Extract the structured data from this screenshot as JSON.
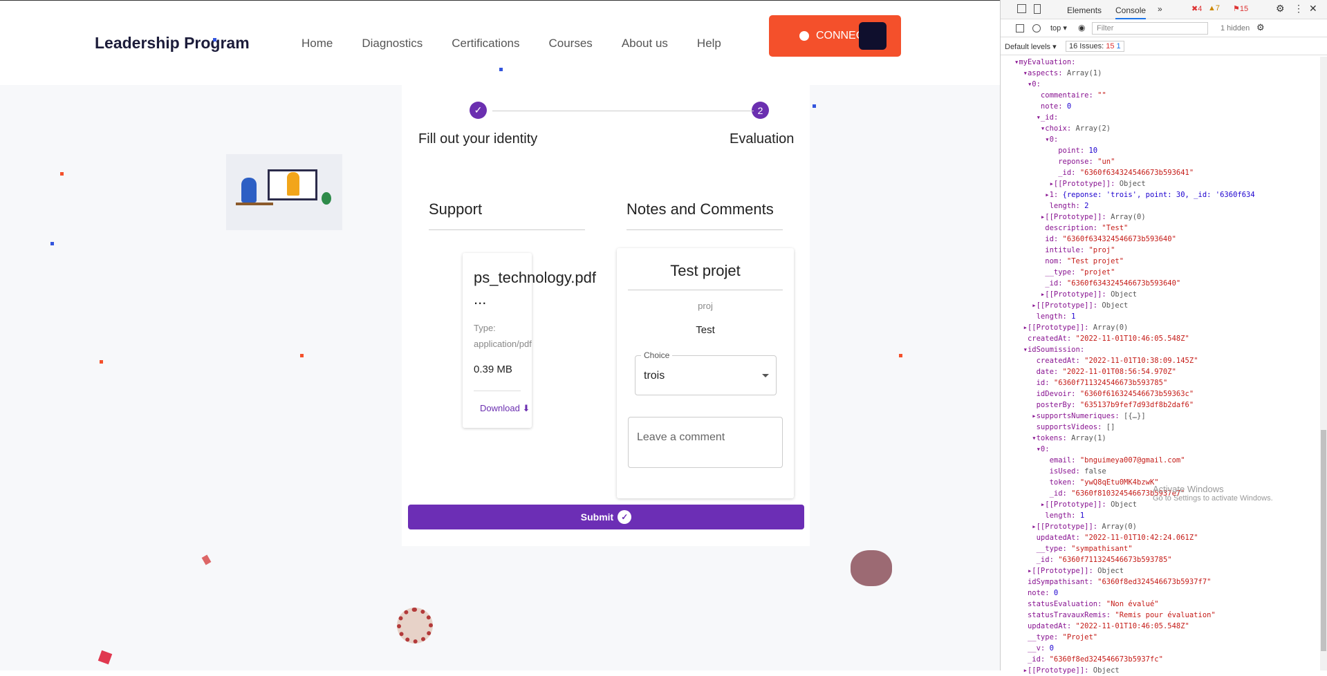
{
  "nav": {
    "brand": "Leadership Program",
    "links": [
      "Home",
      "Diagnostics",
      "Certifications",
      "Courses",
      "About us",
      "Help"
    ],
    "connect": "CONNECT"
  },
  "steps": {
    "step1": "Fill out your identity",
    "step2": "Evaluation",
    "step2_num": "2"
  },
  "support": {
    "title": "Support",
    "file_name": "ps_technology.pdf",
    "ellipsis": "...",
    "type": "Type: application/pdf",
    "size": "0.39 MB",
    "download": "Download"
  },
  "notes": {
    "title": "Notes and Comments",
    "project": "Test projet",
    "intitule": "proj",
    "description": "Test",
    "choice_label": "Choice",
    "choice_value": "trois",
    "comment_placeholder": "Leave a comment"
  },
  "submit": "Submit",
  "devtools": {
    "tabs": [
      "Elements",
      "Console"
    ],
    "errors": "4",
    "warnings": "7",
    "issues_badge": "15",
    "top": "top",
    "filter": "Filter",
    "hidden": "1 hidden",
    "levels": "Default levels",
    "issues": "16 Issues:",
    "issues_err": "15",
    "issues_info": "1",
    "watermark1": "Activate Windows",
    "watermark2": "Go to Settings to activate Windows."
  },
  "tree": [
    "▾myEvaluation:",
    "  ▾aspects: Array(1)",
    "   ▾0:",
    "      commentaire: \"\"",
    "      note: 0",
    "     ▾_id:",
    "      ▾choix: Array(2)",
    "       ▾0:",
    "          point: 10",
    "          reponse: \"un\"",
    "          _id: \"6360f634324546673b593641\"",
    "        ▸[[Prototype]]: Object",
    "       ▸1: {reponse: 'trois', point: 30, _id: '6360f634",
    "        length: 2",
    "      ▸[[Prototype]]: Array(0)",
    "       description: \"Test\"",
    "       id: \"6360f634324546673b593640\"",
    "       intitule: \"proj\"",
    "       nom: \"Test projet\"",
    "       __type: \"projet\"",
    "       _id: \"6360f634324546673b593640\"",
    "      ▸[[Prototype]]: Object",
    "    ▸[[Prototype]]: Object",
    "     length: 1",
    "  ▸[[Prototype]]: Array(0)",
    "   createdAt: \"2022-11-01T10:46:05.548Z\"",
    "  ▾idSoumission:",
    "     createdAt: \"2022-11-01T10:38:09.145Z\"",
    "     date: \"2022-11-01T08:56:54.970Z\"",
    "     id: \"6360f711324546673b593785\"",
    "     idDevoir: \"6360f616324546673b59363c\"",
    "     posterBy: \"635137b9fef7d93df8b2daf6\"",
    "    ▸supportsNumeriques: [{…}]",
    "     supportsVideos: []",
    "    ▾tokens: Array(1)",
    "     ▾0:",
    "        email: \"bnguimeya007@gmail.com\"",
    "        isUsed: false",
    "        token: \"ywQ8qEtu0MK4bzwK\"",
    "        _id: \"6360f810324546673b5937e7\"",
    "      ▸[[Prototype]]: Object",
    "       length: 1",
    "    ▸[[Prototype]]: Array(0)",
    "     updatedAt: \"2022-11-01T10:42:24.061Z\"",
    "     __type: \"sympathisant\"",
    "     _id: \"6360f711324546673b593785\"",
    "   ▸[[Prototype]]: Object",
    "   idSympathisant: \"6360f8ed324546673b5937f7\"",
    "   note: 0",
    "   statusEvaluation: \"Non évalué\"",
    "   statusTravauxRemis: \"Remis pour évaluation\"",
    "   updatedAt: \"2022-11-01T10:46:05.548Z\"",
    "   __type: \"Projet\"",
    "   __v: 0",
    "   _id: \"6360f8ed324546673b5937fc\"",
    "  ▸[[Prototype]]: Object"
  ]
}
